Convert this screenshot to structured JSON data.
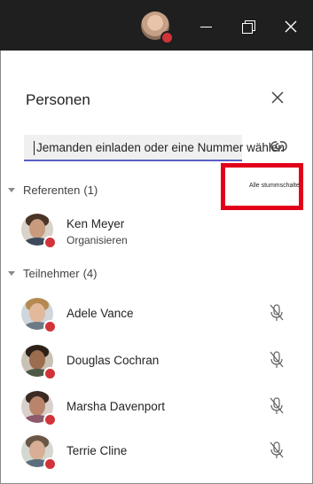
{
  "window": {
    "minimize_icon": "minimize-icon",
    "restore_icon": "restore-icon",
    "close_icon": "close-icon",
    "presence_color": "#d13438"
  },
  "panel": {
    "title": "Personen",
    "invite_placeholder": "Jemanden einladen oder eine Nummer wählen",
    "accent_color": "#5b5fc7"
  },
  "presenters": {
    "label": "Referenten",
    "count": "(1)",
    "mute_all_label": "Alle stummschalten",
    "items": [
      {
        "name": "Ken Meyer",
        "role": "Organisieren"
      }
    ]
  },
  "attendees": {
    "label": "Teilnehmer",
    "count": "(4)",
    "items": [
      {
        "name": "Adele Vance"
      },
      {
        "name": "Douglas Cochran"
      },
      {
        "name": "Marsha Davenport"
      },
      {
        "name": "Terrie Cline"
      }
    ]
  },
  "annotation": {
    "highlight_color": "#e2001a"
  }
}
